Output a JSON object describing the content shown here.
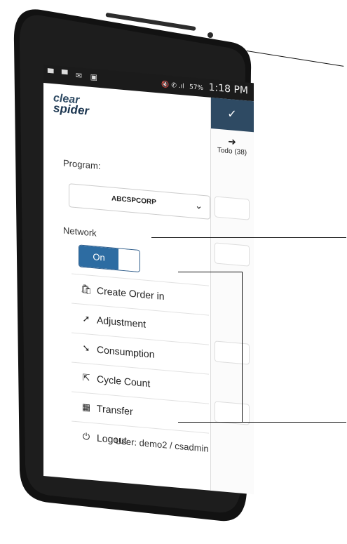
{
  "status_bar": {
    "left_icons": "▀ ▀ ✉ ▣",
    "right_icons": "🔇 ✆ .ıl",
    "battery": "57%",
    "time": "1:18 PM"
  },
  "logo": {
    "line1": "clear",
    "line2": "spider"
  },
  "program": {
    "label": "Program:",
    "selected": "ABCSPCORP"
  },
  "network": {
    "label": "Network",
    "toggle_text": "On"
  },
  "menu": [
    {
      "label": "Create Order in",
      "icon": "shopping-bag-icon",
      "glyph": "🛍"
    },
    {
      "label": "Adjustment",
      "icon": "arrow-up-right-icon",
      "glyph": "➚"
    },
    {
      "label": "Consumption",
      "icon": "arrow-down-right-icon",
      "glyph": "➘"
    },
    {
      "label": "Cycle Count",
      "icon": "share-box-icon",
      "glyph": "⇱"
    },
    {
      "label": "Transfer",
      "icon": "grid-icon",
      "glyph": "▦"
    },
    {
      "label": "Logout",
      "icon": "power-icon",
      "glyph": "⏻"
    }
  ],
  "user_line": "User: demo2 / csadmin",
  "background_panel": {
    "check": "✓",
    "todo_arrow": "➜",
    "todo_label": "Todo (38)"
  },
  "colors": {
    "header_navy": "#2e4a63",
    "toggle_blue": "#2d6ca2"
  }
}
